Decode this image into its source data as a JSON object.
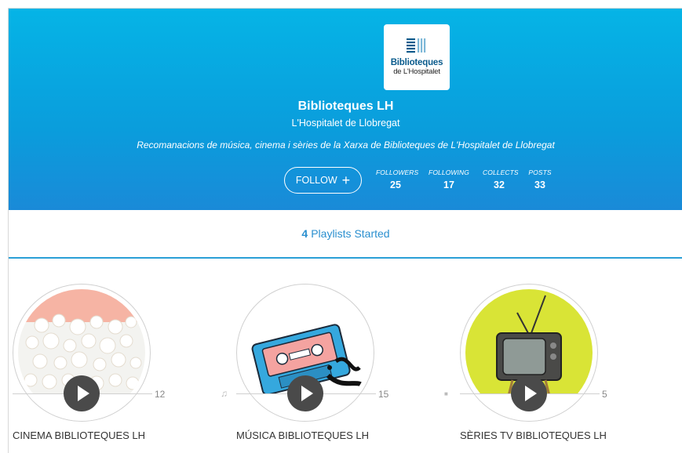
{
  "profile": {
    "logo_line1": "Biblioteques",
    "logo_line2": "de L'Hospitalet",
    "name": "Biblioteques LH",
    "location": "L'Hospitalet de Llobregat",
    "bio": "Recomanacions de música, cinema i sèries de la Xarxa de Biblioteques de L'Hospitalet de Llobregat",
    "follow_label": "FOLLOW",
    "follow_icon": "plus-icon",
    "header_color": "#0aa6e0"
  },
  "stats": [
    {
      "label": "FOLLOWERS",
      "value": "25"
    },
    {
      "label": "FOLLOWING",
      "value": "17"
    },
    {
      "label": "COLLECTS",
      "value": "32"
    },
    {
      "label": "POSTS",
      "value": "33"
    }
  ],
  "playlists_bar": {
    "count": "4",
    "label": "Playlists Started",
    "accent": "#2a9fd6"
  },
  "playlists": [
    {
      "title": "CINEMA BIBLIOTEQUES LH",
      "count": "12",
      "type_icon": "none",
      "art": "popcorn"
    },
    {
      "title": "MÚSICA BIBLIOTEQUES LH",
      "count": "15",
      "type_icon": "music-note-icon",
      "type_glyph": "♫",
      "art": "cassette"
    },
    {
      "title": "SÈRIES TV BIBLIOTEQUES LH",
      "count": "5",
      "type_icon": "video-camera-icon",
      "type_glyph": "■",
      "art": "television"
    }
  ]
}
